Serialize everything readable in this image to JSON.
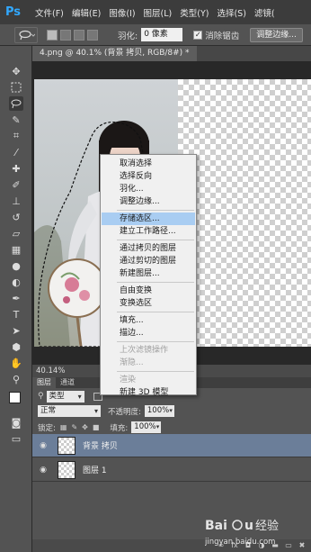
{
  "app": {
    "logo": "Ps"
  },
  "menubar": {
    "items": [
      "文件(F)",
      "编辑(E)",
      "图像(I)",
      "图层(L)",
      "类型(Y)",
      "选择(S)",
      "滤镜("
    ]
  },
  "options": {
    "feather_label": "羽化:",
    "feather_value": "0 像素",
    "antialias_label": "消除锯齿",
    "antialias_checked": true,
    "refine_edge": "调整边缘..."
  },
  "document": {
    "tab_title": "4.png @ 40.1% (背景 拷贝, RGB/8#) *",
    "zoom": "40.14%"
  },
  "layers_panel": {
    "tabs": [
      "图层",
      "通道"
    ],
    "filter_kind": "类型",
    "blend_mode": "正常",
    "opacity_label": "不透明度:",
    "opacity_value": "100%",
    "lock_label": "锁定:",
    "fill_label": "填充:",
    "fill_value": "100%",
    "layers": [
      {
        "name": "背景 拷贝",
        "selected": true
      },
      {
        "name": "图层 1",
        "selected": false
      }
    ]
  },
  "context_menu": {
    "items": [
      {
        "label": "取消选择",
        "enabled": true
      },
      {
        "label": "选择反向",
        "enabled": true
      },
      {
        "label": "羽化...",
        "enabled": true
      },
      {
        "label": "调整边缘...",
        "enabled": true
      },
      {
        "separator": true
      },
      {
        "label": "存储选区...",
        "enabled": true,
        "highlighted": true
      },
      {
        "label": "建立工作路径...",
        "enabled": true
      },
      {
        "separator": true
      },
      {
        "label": "通过拷贝的图层",
        "enabled": true
      },
      {
        "label": "通过剪切的图层",
        "enabled": true
      },
      {
        "label": "新建图层...",
        "enabled": true
      },
      {
        "separator": true
      },
      {
        "label": "自由变换",
        "enabled": true
      },
      {
        "label": "变换选区",
        "enabled": true
      },
      {
        "separator": true
      },
      {
        "label": "填充...",
        "enabled": true
      },
      {
        "label": "描边...",
        "enabled": true
      },
      {
        "separator": true
      },
      {
        "label": "上次滤镜操作",
        "enabled": false
      },
      {
        "label": "渐隐...",
        "enabled": false
      },
      {
        "separator": true
      },
      {
        "label": "渲染",
        "enabled": false
      },
      {
        "label": "新建 3D 模型",
        "enabled": true
      }
    ]
  },
  "colors": {
    "highlight": "#a9cdf2",
    "selected_layer": "#6b7e99",
    "ps_blue": "#31a8ff"
  },
  "watermark": {
    "brand": "Baidu",
    "text": "经验",
    "url": "jingyan.baidu.com"
  }
}
